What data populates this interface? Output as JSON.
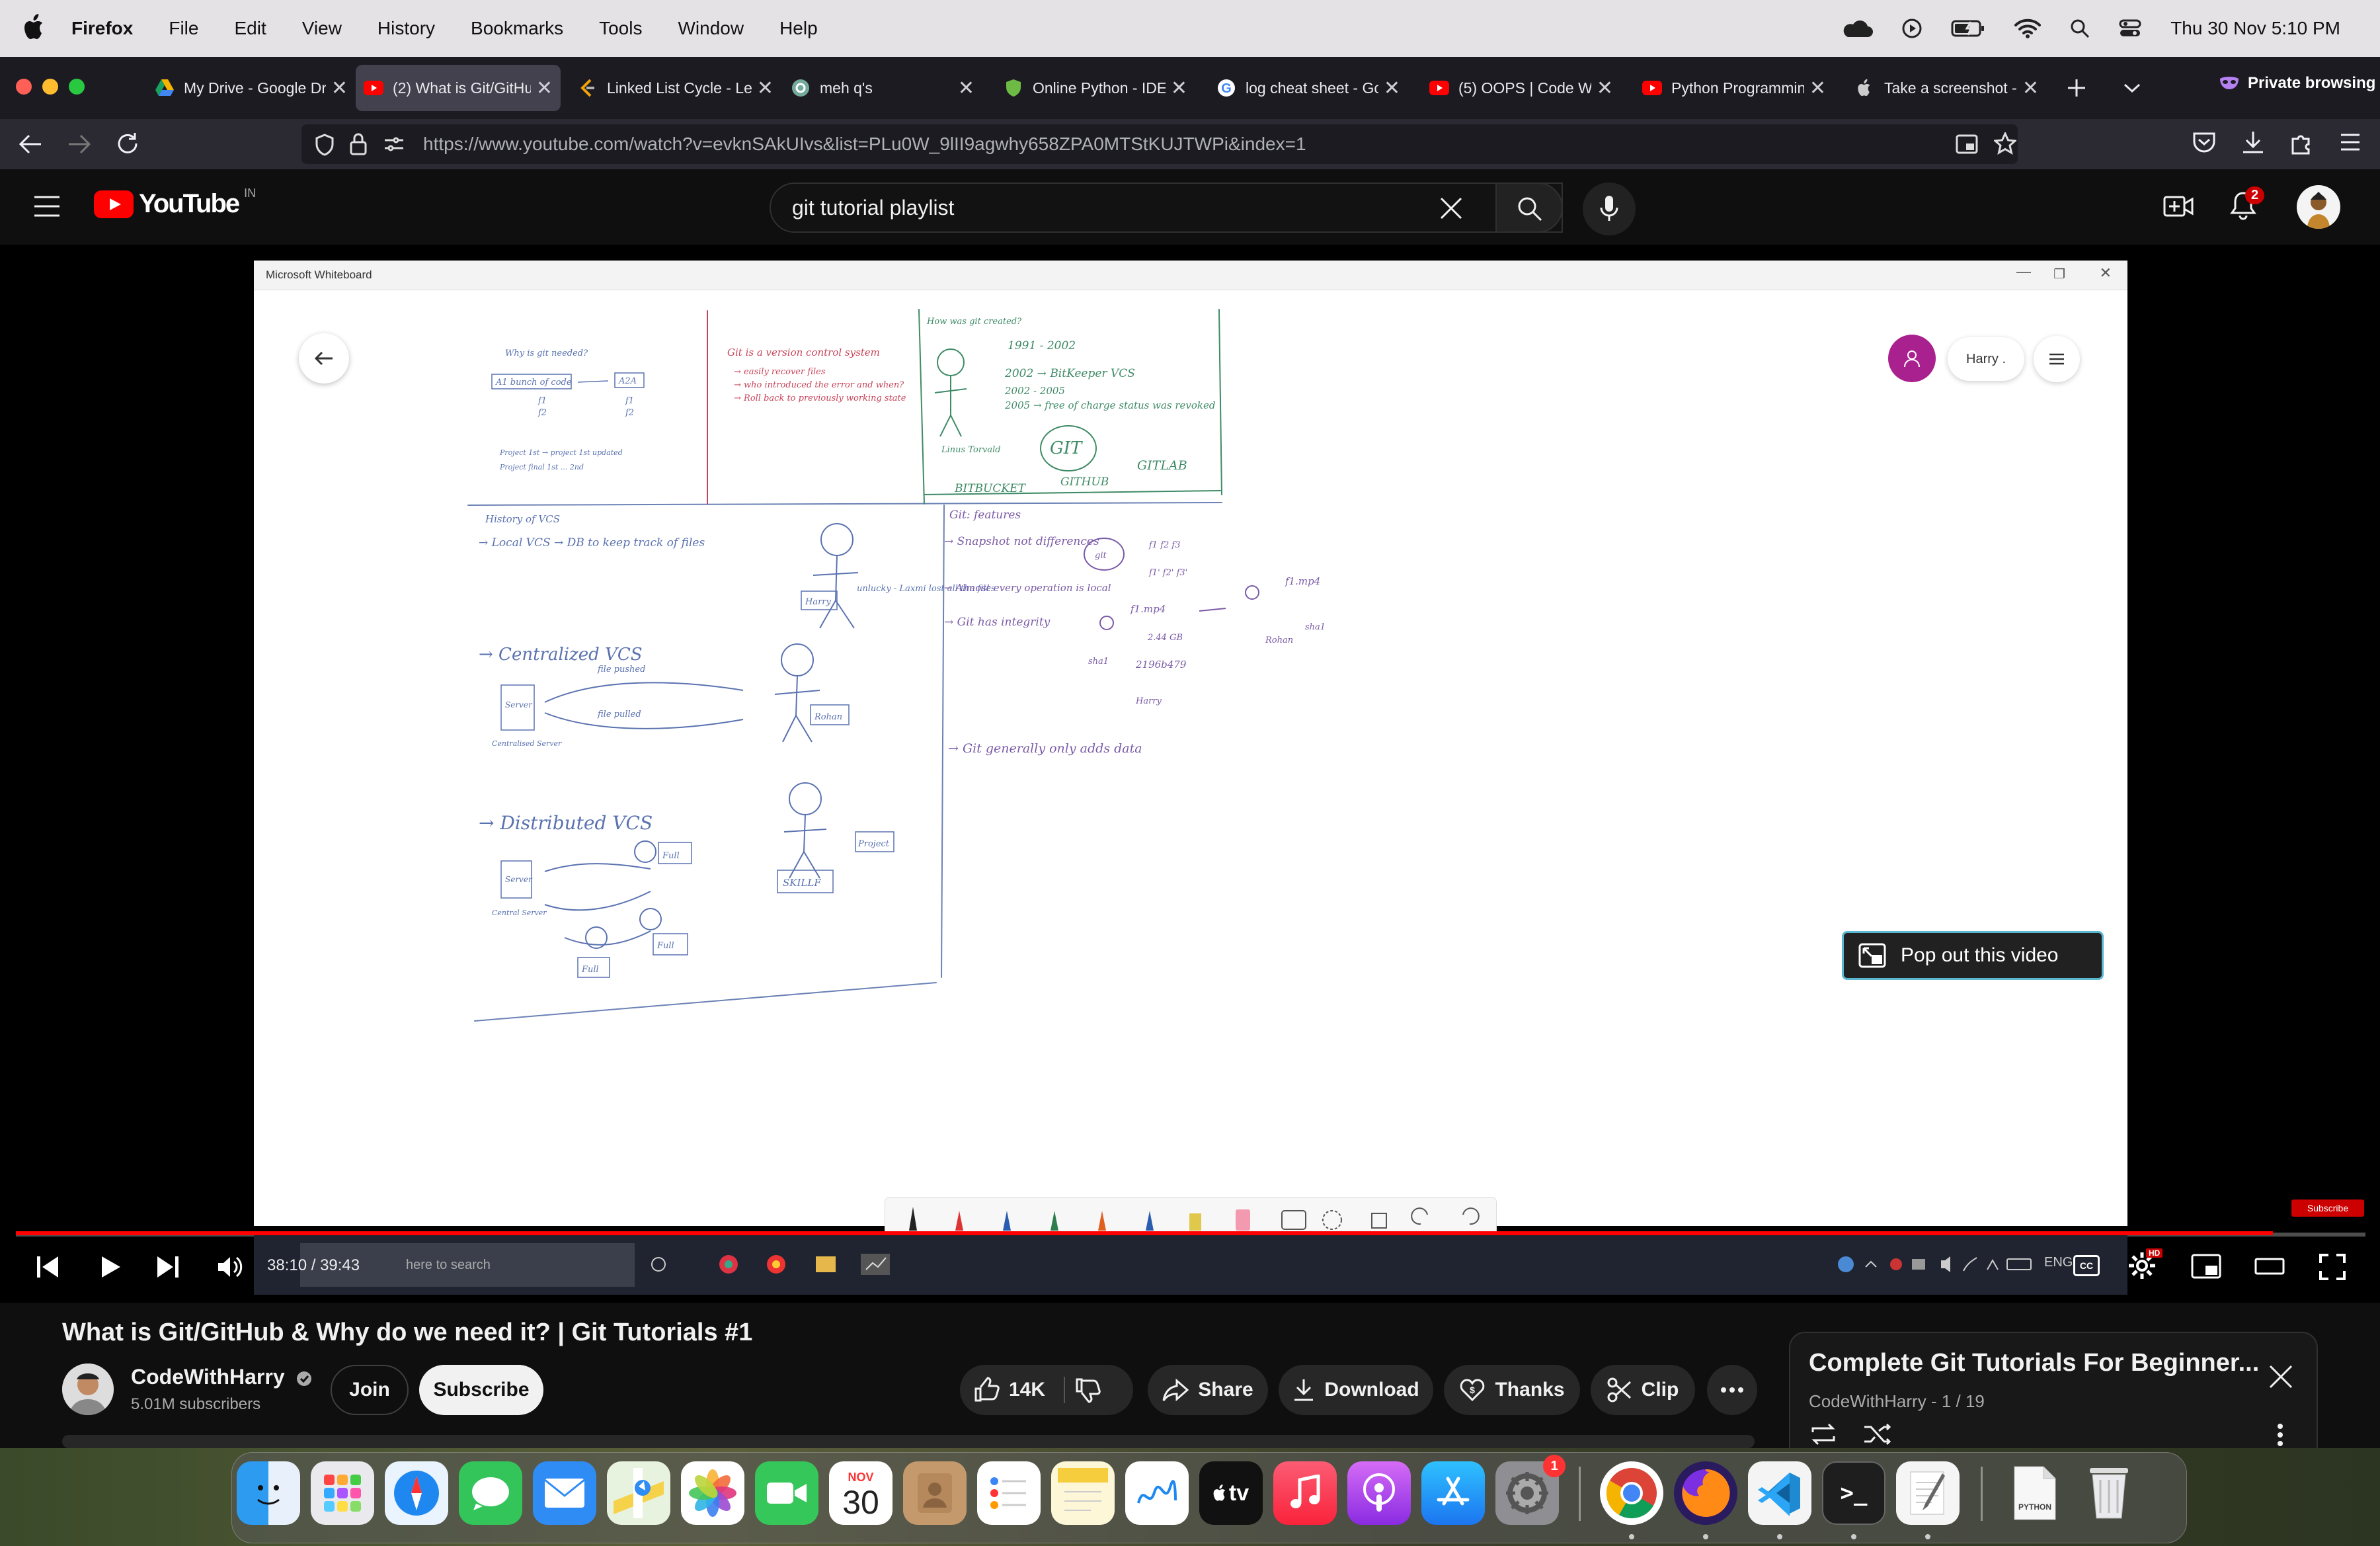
{
  "menubar": {
    "app_name": "Firefox",
    "menus": [
      "File",
      "Edit",
      "View",
      "History",
      "Bookmarks",
      "Tools",
      "Window",
      "Help"
    ],
    "clock": "Thu 30 Nov  5:10 PM"
  },
  "browser": {
    "tabs": [
      {
        "label": "My Drive - Google Dr",
        "icon": "google-drive-icon"
      },
      {
        "label": "(2) What is Git/GitHu",
        "icon": "youtube-icon",
        "active": true
      },
      {
        "label": "Linked List Cycle - Le",
        "icon": "leetcode-icon"
      },
      {
        "label": "meh q's",
        "icon": "chatgpt-icon"
      },
      {
        "label": "Online Python - IDE,",
        "icon": "shield-icon"
      },
      {
        "label": "log cheat sheet - Go",
        "icon": "google-icon"
      },
      {
        "label": "(5) OOPS | Code With",
        "icon": "youtube-icon"
      },
      {
        "label": "Python Programming",
        "icon": "youtube-icon"
      },
      {
        "label": "Take a screenshot -",
        "icon": "apple-icon"
      }
    ],
    "private_label": "Private browsing",
    "url": "https://www.youtube.com/watch?v=evknSAkUIvs&list=PLu0W_9lII9agwhy658ZPA0MTStKUJTWPi&index=1"
  },
  "youtube": {
    "logo_text": "YouTube",
    "region": "IN",
    "search_query": "git tutorial playlist",
    "notification_count": "2"
  },
  "player": {
    "whiteboard_title": "Microsoft Whiteboard",
    "whiteboard_user": "Harry .",
    "popout_label": "Pop out this video",
    "time_current": "38:10",
    "time_total": "39:43",
    "time_display": "38:10 / 39:43",
    "taskbar_search": "here to search",
    "taskbar_lang": "ENG",
    "subscribe_watermark": "Subscribe",
    "hd_badge": "HD",
    "progress": 0.9606,
    "sketch": {
      "top_left": [
        "Why is git needed?",
        "A1 bunch of code",
        "f1",
        "f2",
        "A2A",
        "f1",
        "f2",
        "Project 1st → project 1st updated",
        "Project final 1st ... 2nd"
      ],
      "top_middle": [
        "Git is a version control system",
        "→ easily recover files",
        "→ who introduced the error and when?",
        "→ Roll back to previously working state"
      ],
      "top_right": [
        "How was git created?",
        "1991 - 2002",
        "2002 → BitKeeper VCS",
        "2002 - 2005",
        "2005 → free of charge status was revoked",
        "Linus Torvald",
        "GIT",
        "BITBUCKET",
        "GITHUB",
        "GITLAB"
      ],
      "history": [
        "History of VCS",
        "→ Local VCS → DB to keep track of files",
        "Harry",
        "unlucky - Laxmi lost all the files"
      ],
      "centralized": [
        "→ Centralized VCS",
        "file pushed",
        "file pulled",
        "Server",
        "Centralised Server",
        "Rohan"
      ],
      "distributed": [
        "→ Distributed VCS",
        "Server",
        "Central Server",
        "Full",
        "Full",
        "Full",
        "Project",
        "SKILLF"
      ],
      "features": [
        "Git: features",
        "→ Snapshot not differences",
        "git",
        "f1 f2 f3",
        "f1' f2' f3'",
        "→ Almost every operation is local",
        "→ Git has integrity",
        "f1.mp4",
        "2.44 GB",
        "sha1",
        "2196b479",
        "Harry",
        "Rohan",
        "sha1",
        "f1.mp4",
        "→ Git generally only adds data"
      ]
    }
  },
  "video": {
    "title": "What is Git/GitHub & Why do we need it? | Git Tutorials #1",
    "channel": "CodeWithHarry",
    "subscribers": "5.01M subscribers",
    "join_label": "Join",
    "subscribe_label": "Subscribe",
    "likes": "14K",
    "share_label": "Share",
    "download_label": "Download",
    "thanks_label": "Thanks",
    "clip_label": "Clip"
  },
  "playlist": {
    "title": "Complete Git Tutorials For Beginner...",
    "subtitle": "CodeWithHarry - 1 / 19"
  },
  "dock": {
    "calendar_month": "NOV",
    "calendar_day": "30",
    "settings_badge": "1",
    "apps": [
      "finder-icon",
      "launchpad-icon",
      "safari-icon",
      "messages-icon",
      "mail-icon",
      "maps-icon",
      "photos-icon",
      "facetime-icon",
      "calendar-icon",
      "contacts-icon",
      "reminders-icon",
      "notes-icon",
      "freeform-icon",
      "tv-icon",
      "music-icon",
      "podcasts-icon",
      "app-store-icon",
      "system-settings-icon",
      "chrome-icon",
      "firefox-icon",
      "vscode-icon",
      "terminal-icon",
      "textedit-icon",
      "python-file-icon",
      "trash-icon"
    ],
    "python_file_label": "PYTHON",
    "tv_label": "tv"
  }
}
